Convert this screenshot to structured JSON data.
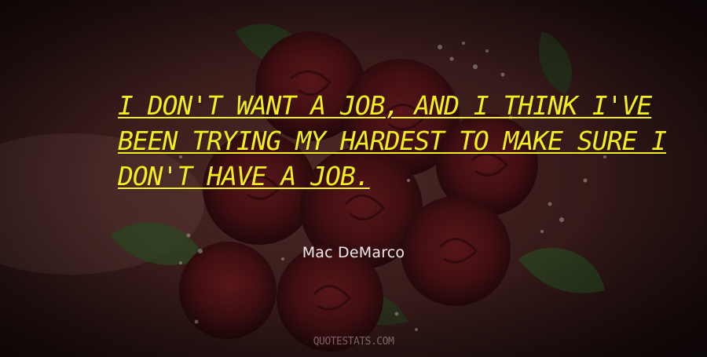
{
  "quote": {
    "lines": [
      "I DON'T WANT A JOB, AND I THINK I'VE",
      "BEEN TRYING MY HARDEST TO MAKE SURE I",
      "DON'T HAVE A JOB."
    ],
    "color": "#f5ee1a"
  },
  "author": "Mac DeMarco",
  "watermark": "QUOTESTATS.COM",
  "background": {
    "subject": "bouquet of dark red roses with baby's breath",
    "colors": [
      "#3a1a1a",
      "#6a1f22",
      "#3f5a2e"
    ]
  }
}
